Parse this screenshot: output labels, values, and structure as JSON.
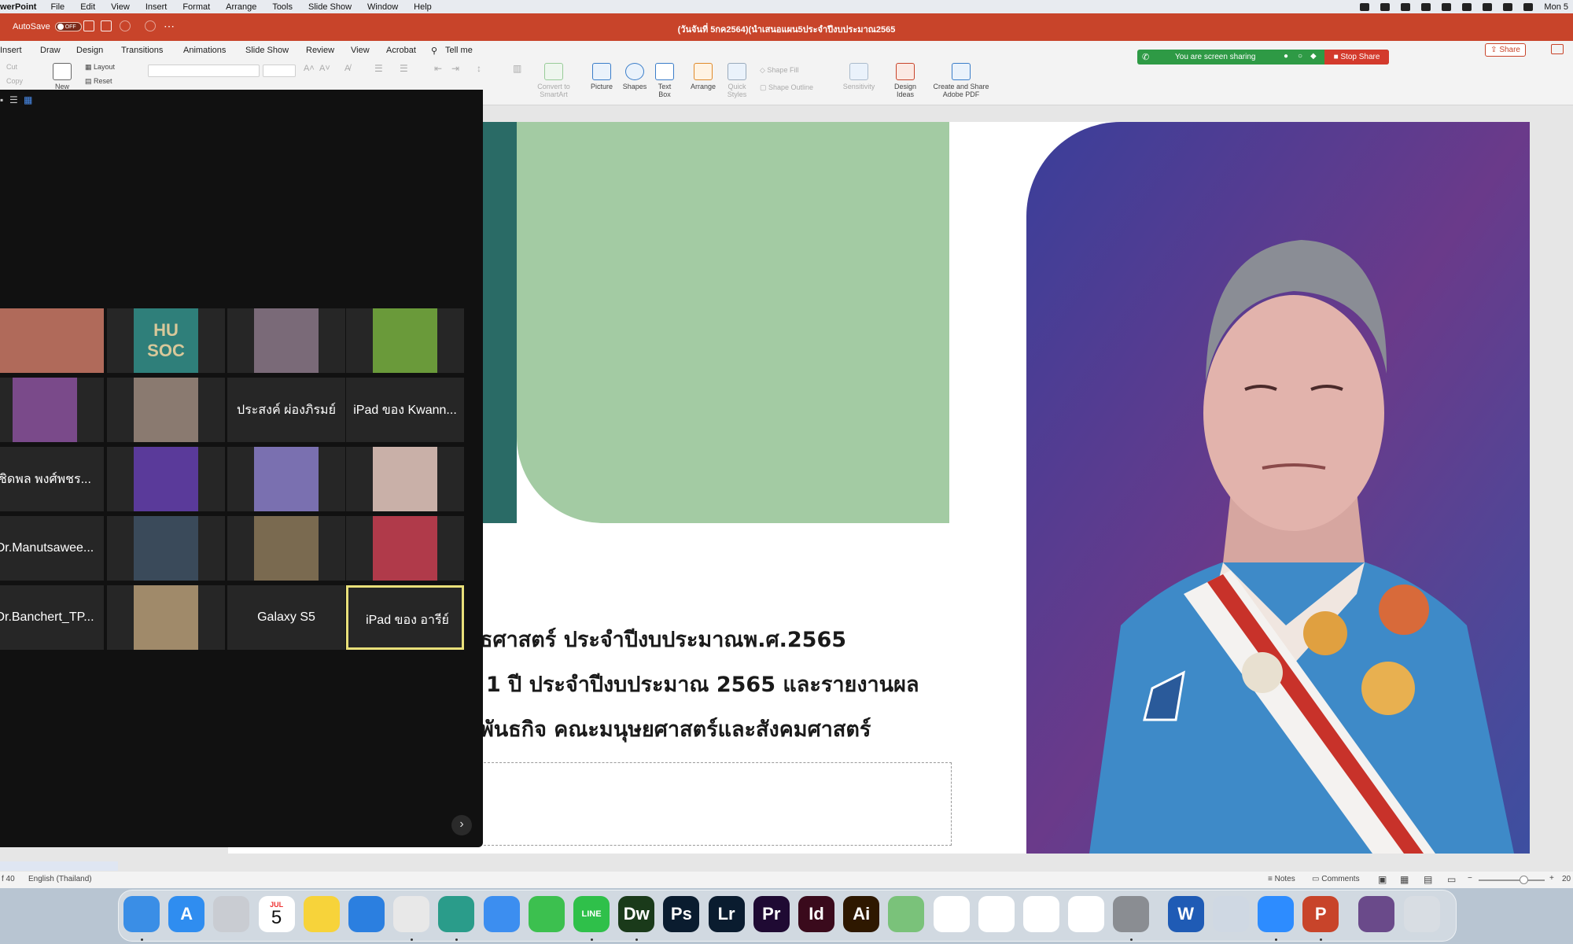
{
  "menubar": {
    "app_name": "werPoint",
    "items": [
      "File",
      "Edit",
      "View",
      "Insert",
      "Format",
      "Arrange",
      "Tools",
      "Slide Show",
      "Window",
      "Help"
    ],
    "clock": "Mon 5"
  },
  "titlebar": {
    "autosave_label": "AutoSave",
    "autosave_state": "OFF",
    "document_title": "(วันจันที่ 5กค2564)(นำเสนอแผน5ประจำปีงบประมาณ2565"
  },
  "tabs": [
    "Insert",
    "Draw",
    "Design",
    "Transitions",
    "Animations",
    "Slide Show",
    "Review",
    "View",
    "Acrobat"
  ],
  "tell_me": "Tell me",
  "share_label": "Share",
  "ribbon": {
    "cut": "Cut",
    "copy": "Copy",
    "new_label": "New",
    "layout": "Layout",
    "reset": "Reset",
    "convert_smartart": "Convert to SmartArt",
    "picture": "Picture",
    "shapes": "Shapes",
    "text_box": "Text Box",
    "arrange": "Arrange",
    "quick_styles": "Quick Styles",
    "shape_fill": "Shape Fill",
    "shape_outline": "Shape Outline",
    "sensitivity": "Sensitivity",
    "design_ideas": "Design Ideas",
    "create_pdf": "Create and Share Adobe PDF"
  },
  "sharebar": {
    "status": "You are screen sharing",
    "stop": "Stop Share"
  },
  "slide": {
    "line1": "ธศาสตร์ ประจำปีงบประมาณพ.ศ.2565",
    "line2": "1 ปี ประจำปีงบประมาณ 2565 และรายงานผล",
    "line3": "พันธกิจ คณะมนุษยศาสตร์และสังคมศาสตร์",
    "colors": {
      "teal": "#2a6b66",
      "sage": "#a3cba3"
    }
  },
  "zoom": {
    "tiles": [
      {
        "name": "",
        "photo": "#b06a5a"
      },
      {
        "name": "",
        "photo": "#2f7f7a",
        "logo": "HU SOC"
      },
      {
        "name": "",
        "photo": "#7a6a78"
      },
      {
        "name": "",
        "photo": "#6a9a3a"
      },
      {
        "name": "",
        "photo": "#7a4a8a"
      },
      {
        "name": "",
        "photo": "#8a7a70"
      },
      {
        "name": "ประสงค์ ผ่องภิรมย์",
        "photo": ""
      },
      {
        "name": "iPad ของ Kwann...",
        "photo": ""
      },
      {
        "name": "ชิดพล พงศ์พชร...",
        "photo": ""
      },
      {
        "name": "",
        "photo": "#5a3a9a"
      },
      {
        "name": "",
        "photo": "#7a70b0"
      },
      {
        "name": "",
        "photo": "#c9b0a8"
      },
      {
        "name": "Dr.Manutsawee...",
        "photo": ""
      },
      {
        "name": "",
        "photo": "#3a4a5a"
      },
      {
        "name": "",
        "photo": "#7a6a50"
      },
      {
        "name": "",
        "photo": "#b03a4a"
      },
      {
        "name": "Dr.Banchert_TP...",
        "photo": ""
      },
      {
        "name": "",
        "photo": "#a08a6a"
      },
      {
        "name": "Galaxy S5",
        "photo": ""
      },
      {
        "name": "iPad ของ อารีย์",
        "photo": "",
        "active": true
      }
    ]
  },
  "statusbar": {
    "slide_count": "f 40",
    "language": "English (Thailand)",
    "notes": "Notes",
    "comments": "Comments",
    "zoom_pct": "20"
  },
  "dock": {
    "calendar_month": "JUL",
    "calendar_day": "5",
    "apps": [
      {
        "icon": "finder-icon",
        "color": "#3a8ee6",
        "label": ""
      },
      {
        "icon": "app-store-icon",
        "color": "#2f8df0",
        "label": "A"
      },
      {
        "icon": "launchpad-icon",
        "color": "#c9ccd2",
        "label": ""
      },
      {
        "icon": "calendar-icon",
        "color": "#ffffff",
        "label": ""
      },
      {
        "icon": "notes-icon",
        "color": "#f7d33a",
        "label": ""
      },
      {
        "icon": "safari-icon",
        "color": "#2b7fe0",
        "label": ""
      },
      {
        "icon": "chrome-icon",
        "color": "#e8e8e8",
        "label": ""
      },
      {
        "icon": "edge-icon",
        "color": "#2a9c8a",
        "label": ""
      },
      {
        "icon": "mail-icon",
        "color": "#3c8ef0",
        "label": ""
      },
      {
        "icon": "facetime-icon",
        "color": "#3cc04f",
        "label": ""
      },
      {
        "icon": "line-icon",
        "color": "#2fc04a",
        "label": "LINE"
      },
      {
        "icon": "dreamweaver-icon",
        "color": "#1a3a1a",
        "label": "Dw"
      },
      {
        "icon": "photoshop-icon",
        "color": "#0a1c2f",
        "label": "Ps"
      },
      {
        "icon": "lightroom-icon",
        "color": "#0a1c2f",
        "label": "Lr"
      },
      {
        "icon": "premiere-icon",
        "color": "#1f0a33",
        "label": "Pr"
      },
      {
        "icon": "indesign-icon",
        "color": "#3a0a1c",
        "label": "Id"
      },
      {
        "icon": "illustrator-icon",
        "color": "#2e1800",
        "label": "Ai"
      },
      {
        "icon": "maps-icon",
        "color": "#7ac27a",
        "label": ""
      },
      {
        "icon": "photos-icon",
        "color": "#ffffff",
        "label": ""
      },
      {
        "icon": "numbers-icon",
        "color": "#ffffff",
        "label": ""
      },
      {
        "icon": "keynote-icon",
        "color": "#ffffff",
        "label": ""
      },
      {
        "icon": "pages-icon",
        "color": "#ffffff",
        "label": ""
      },
      {
        "icon": "system-preferences-icon",
        "color": "#8a8d92",
        "label": ""
      },
      {
        "icon": "word-icon",
        "color": "#1f5bb5",
        "label": "W"
      },
      {
        "icon": "preview-icon",
        "color": "#cfd8e3",
        "label": ""
      },
      {
        "icon": "zoom-icon",
        "color": "#2d8cff",
        "label": ""
      },
      {
        "icon": "powerpoint-icon",
        "color": "#c8442a",
        "label": "P"
      },
      {
        "icon": "document-icon",
        "color": "#6a4a8a",
        "label": ""
      },
      {
        "icon": "trash-icon",
        "color": "#d8dde3",
        "label": ""
      }
    ]
  }
}
